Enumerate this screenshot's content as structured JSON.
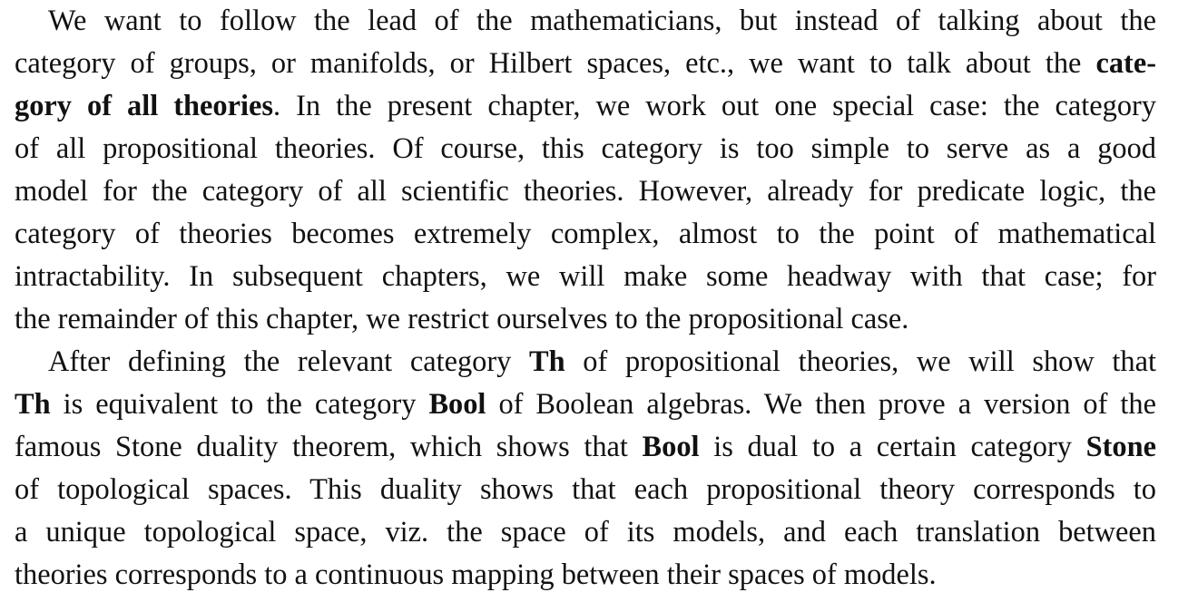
{
  "paragraphs": [
    {
      "lines": [
        [
          "We want to follow the lead of the mathematicians, but instead of talking about the"
        ],
        [
          "category of groups, or manifolds, or Hilbert spaces, etc., we want to talk about the ",
          {
            "b": "cate-"
          }
        ],
        [
          {
            "b": "gory of all theories"
          },
          ". In the present chapter, we work out one special case: the category"
        ],
        [
          "of all propositional theories. Of course, this category is too simple to serve as a good"
        ],
        [
          "model for the category of all scientific theories. However, already for predicate logic, the"
        ],
        [
          "category of theories becomes extremely complex, almost to the point of mathematical"
        ],
        [
          "intractability. In subsequent chapters, we will make some headway with that case; for"
        ],
        [
          "the remainder of this chapter, we restrict ourselves to the propositional case."
        ]
      ]
    },
    {
      "lines": [
        [
          "After defining the relevant category ",
          {
            "b": "Th"
          },
          " of propositional theories, we will show that"
        ],
        [
          {
            "b": "Th"
          },
          " is equivalent to the category ",
          {
            "b": "Bool"
          },
          " of Boolean algebras. We then prove a version of the"
        ],
        [
          "famous Stone duality theorem, which shows that ",
          {
            "b": "Bool"
          },
          " is dual to a certain category ",
          {
            "b": "Stone"
          }
        ],
        [
          "of topological spaces. This duality shows that each propositional theory corresponds to"
        ],
        [
          "a unique topological space, viz. the space of its models, and each translation between"
        ],
        [
          "theories corresponds to a continuous mapping between their spaces of models."
        ]
      ]
    }
  ]
}
